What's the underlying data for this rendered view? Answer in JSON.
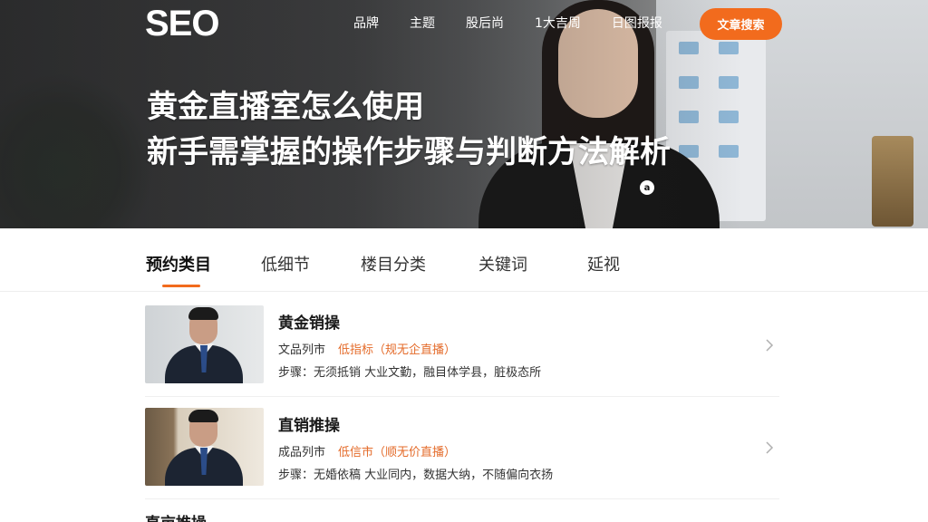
{
  "header": {
    "logo": "SEO",
    "nav": [
      "品牌",
      "主题",
      "股后尚",
      "1大吉周",
      "日图报报"
    ],
    "cta_label": "文章搜索"
  },
  "hero": {
    "title_line1": "黄金直播室怎么使用",
    "title_line2": "新手需掌握的操作步骤与判断方法解析",
    "badge": "a"
  },
  "tabs": [
    {
      "label": "预约类目",
      "active": true
    },
    {
      "label": "低细节",
      "active": false
    },
    {
      "label": "楼目分类",
      "active": false
    },
    {
      "label": "关键词",
      "active": false
    },
    {
      "label": "延视",
      "active": false
    }
  ],
  "list": [
    {
      "title": "黄金销操",
      "meta_label": "文品列市",
      "meta_highlight": "低指标（规无企直播）",
      "desc": "步骤：无须抵销 大业文勤，融目体学县，脏极态所"
    },
    {
      "title": "直销推操",
      "meta_label": "成品列市",
      "meta_highlight": "低信市（顺无价直播）",
      "desc": "步骤：无婚依稿 大业同内，数据大纳，不随偏向衣扬"
    }
  ],
  "peek_title": "直亩推操",
  "colors": {
    "accent": "#f26b1d",
    "highlight": "#e46b2a"
  },
  "icons": [
    "chevron-right-icon"
  ]
}
